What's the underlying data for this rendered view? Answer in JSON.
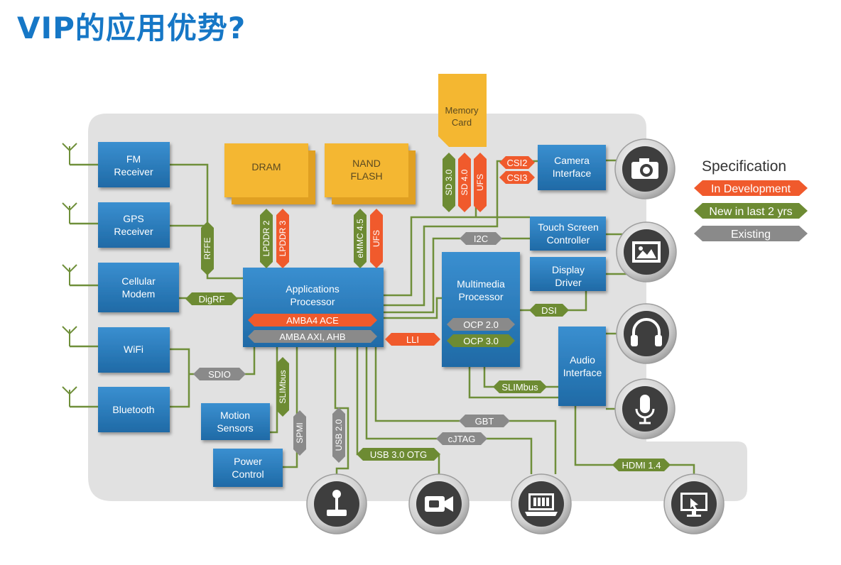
{
  "title": "VIP的应用优势?",
  "colors": {
    "blue": "#2b7dbd",
    "orange": "#f4b731",
    "red": "#f05a2c",
    "green": "#6d8b33",
    "gray": "#8a8a8a",
    "wire": "#6f8f3a",
    "panel": "#e1e1e1"
  },
  "memory_card": "Memory\nCard",
  "dram": "DRAM",
  "nand": "NAND\nFLASH",
  "blocks": {
    "fm": "FM\nReceiver",
    "gps": "GPS\nReceiver",
    "cellular": "Cellular\nModem",
    "wifi": "WiFi",
    "bluetooth": "Bluetooth",
    "motion": "Motion\nSensors",
    "power": "Power\nControl",
    "app": "Applications\nProcessor",
    "multimedia": "Multimedia\nProcessor",
    "camera": "Camera\nInterface",
    "touch": "Touch Screen\nController",
    "display": "Display\nDriver",
    "audio": "Audio\nInterface"
  },
  "buses": {
    "amba4": "AMBA4 ACE",
    "amba_axi": "AMBA AXI, AHB",
    "ocp2": "OCP 2.0",
    "ocp3": "OCP 3.0",
    "lli": "LLI",
    "digrf": "DigRF",
    "sdio": "SDIO",
    "rffe": "RFFE",
    "slimbus_v": "SLIMbus",
    "slimbus_h": "SLIMbus",
    "spmi": "SPMI",
    "usb2": "USB 2.0",
    "usb3": "USB 3.0 OTG",
    "gbt": "GBT",
    "cjtag": "cJTAG",
    "hdmi": "HDMI 1.4",
    "dsi": "DSI",
    "i2c": "I2C",
    "csi2": "CSI2",
    "csi3": "CSI3",
    "lpddr2": "LPDDR 2",
    "lpddr3": "LPDDR 3",
    "emmc": "eMMC 4.5",
    "ufs_nand": "UFS",
    "sd3": "SD 3.0",
    "sd4": "SD 4.0",
    "ufs_card": "UFS"
  },
  "legend": {
    "title": "Specification",
    "items": [
      "In Development",
      "New in last 2 yrs",
      "Existing"
    ]
  },
  "icons": [
    "camera-icon",
    "image-icon",
    "headphones-icon",
    "microphone-icon",
    "joystick-icon",
    "video-camera-icon",
    "laptop-icon",
    "monitor-icon"
  ]
}
